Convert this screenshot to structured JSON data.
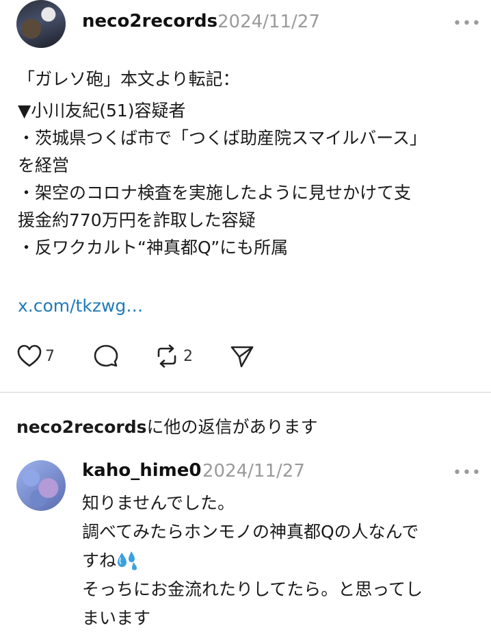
{
  "post": {
    "username": "neco2records",
    "date": "2024/11/27",
    "more_glyph": "•••",
    "lines": [
      "「ガレソ砲」本文より転記：",
      "▼小川友紀(51)容疑者",
      "・茨城県つくば市で「つくば助産院スマイルバース」",
      "を経営",
      "・架空のコロナ検査を実施したように見せかけて支",
      "援金約770万円を詐取した容疑",
      "・反ワクカルト“神真都Q”にも所属"
    ],
    "link": "x.com/tkzwg…",
    "actions": {
      "like_count": "7",
      "repost_count": "2"
    }
  },
  "more_replies": {
    "user": "neco2records",
    "text": "に他の返信があります"
  },
  "reply": {
    "username": "kaho_hime0",
    "date": "2024/11/27",
    "more_glyph": "•••",
    "lines": [
      "知りませんでした。",
      "調べてみたらホンモノの神真都Qの人なんで",
      "すね",
      "そっちにお金流れたりしてたら。と思ってし",
      "まいます"
    ],
    "emoji_icon": "sweat-droplets-icon"
  },
  "colors": {
    "link": "#1f7ab8",
    "date": "#9a9a9a",
    "droplet": "#3aa0e0"
  }
}
